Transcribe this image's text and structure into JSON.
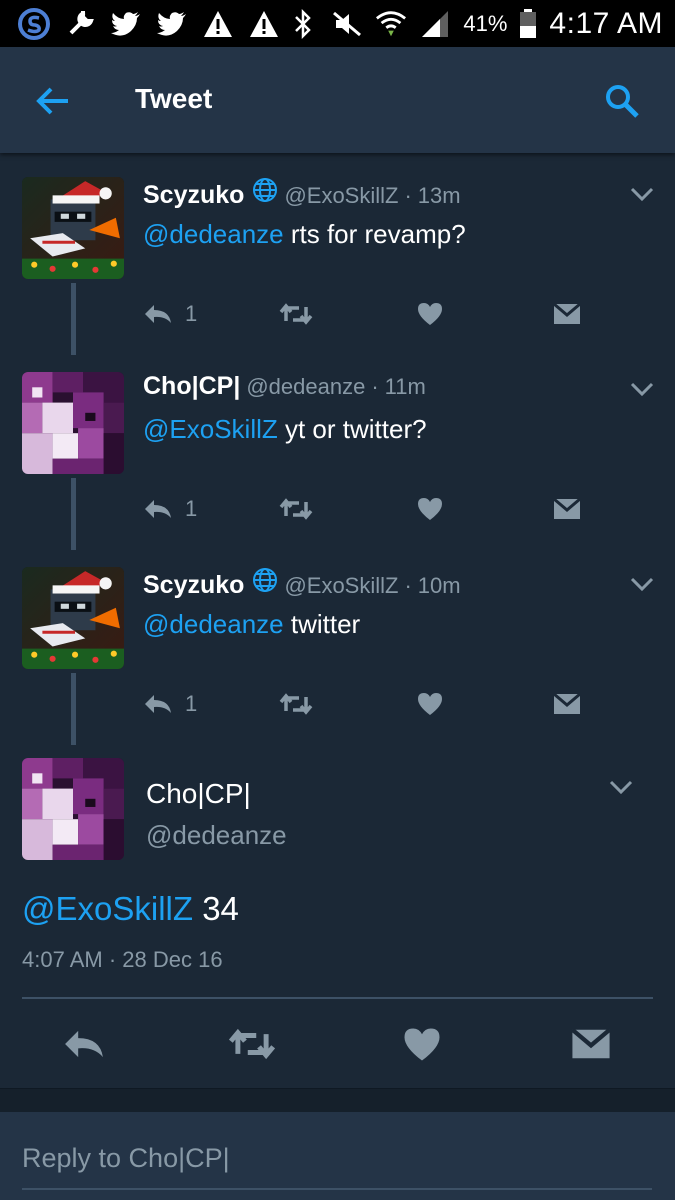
{
  "status_bar": {
    "battery_percent": "41%",
    "time": "4:17 AM",
    "icons": [
      "s-app-icon",
      "wrench-icon",
      "twitter-bird-icon",
      "twitter-bird-icon",
      "warning-icon",
      "warning-icon",
      "bluetooth-icon",
      "mute-icon",
      "wifi-icon",
      "signal-icon",
      "battery-icon"
    ]
  },
  "header": {
    "title": "Tweet",
    "back_icon": "arrow-left-icon",
    "search_icon": "search-icon"
  },
  "colors": {
    "background": "#1b2836",
    "appbar": "#243447",
    "accent": "#1da1f2",
    "secondary_text": "#8899a6",
    "divider": "#3d5166"
  },
  "replies": [
    {
      "name": "Scyzuko",
      "verified_globe": true,
      "handle": "@ExoSkillZ",
      "dot": "·",
      "time": "13m",
      "mention": "@dedeanze",
      "text": " rts for revamp?",
      "reply_count": "1",
      "avatar": "santa-hat-avatar"
    },
    {
      "name": "Cho|CP|",
      "verified_globe": false,
      "handle": "@dedeanze",
      "dot": "·",
      "time": "11m",
      "mention": "@ExoSkillZ",
      "text": " yt or twitter?",
      "reply_count": "1",
      "avatar": "purple-pixel-avatar"
    },
    {
      "name": "Scyzuko",
      "verified_globe": true,
      "handle": "@ExoSkillZ",
      "dot": "·",
      "time": "10m",
      "mention": "@dedeanze",
      "text": " twitter",
      "reply_count": "1",
      "avatar": "santa-hat-avatar"
    }
  ],
  "main_tweet": {
    "name": "Cho|CP|",
    "handle": "@dedeanze",
    "mention": "@ExoSkillZ",
    "text": " 34",
    "time": "4:07 AM",
    "dot": "·",
    "date": "28 Dec 16",
    "avatar": "purple-pixel-avatar"
  },
  "reply_box": {
    "placeholder": "Reply to Cho|CP|"
  }
}
